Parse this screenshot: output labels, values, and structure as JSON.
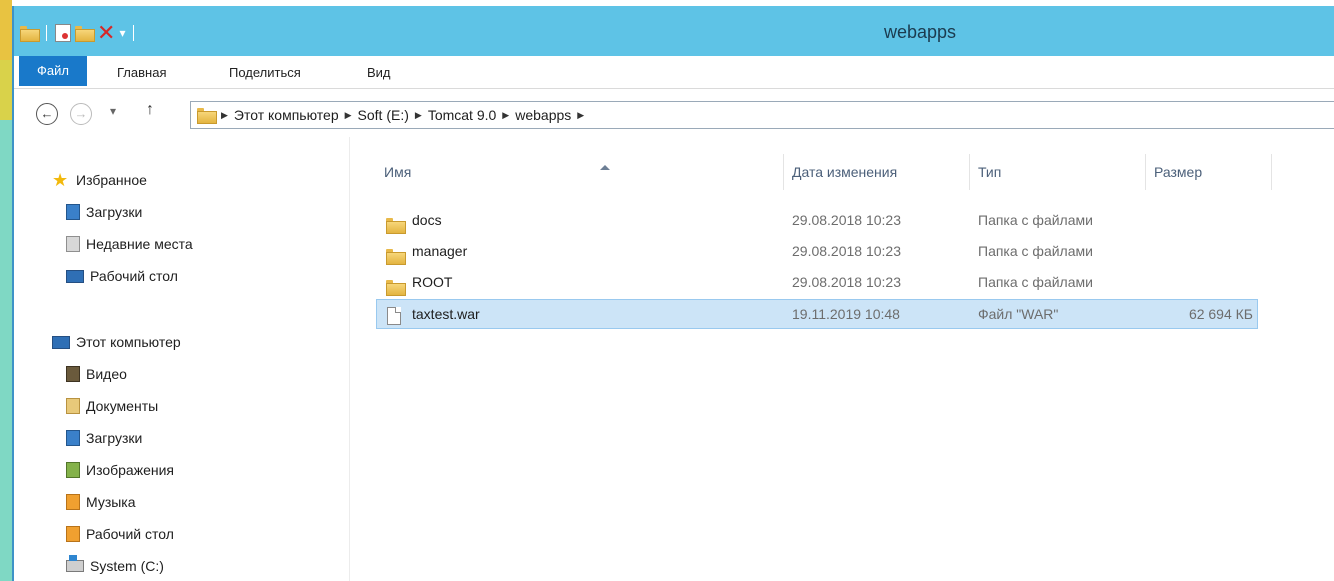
{
  "window": {
    "title": "webapps"
  },
  "ribbon": {
    "tabs": [
      "Файл",
      "Главная",
      "Поделиться",
      "Вид"
    ]
  },
  "address": {
    "crumbs": [
      "Этот компьютер",
      "Soft (E:)",
      "Tomcat 9.0",
      "webapps"
    ]
  },
  "navpane": {
    "favorites": {
      "label": "Избранное",
      "items": [
        "Загрузки",
        "Недавние места",
        "Рабочий стол"
      ]
    },
    "computer": {
      "label": "Этот компьютер",
      "items": [
        "Видео",
        "Документы",
        "Загрузки",
        "Изображения",
        "Музыка",
        "Рабочий стол",
        "System (C:)"
      ]
    }
  },
  "filelist": {
    "columns": [
      "Имя",
      "Дата изменения",
      "Тип",
      "Размер"
    ],
    "rows": [
      {
        "name": "docs",
        "date": "29.08.2018 10:23",
        "type": "Папка с файлами",
        "size": ""
      },
      {
        "name": "manager",
        "date": "29.08.2018 10:23",
        "type": "Папка с файлами",
        "size": ""
      },
      {
        "name": "ROOT",
        "date": "29.08.2018 10:23",
        "type": "Папка с файлами",
        "size": ""
      },
      {
        "name": "taxtest.war",
        "date": "19.11.2019 10:48",
        "type": "Файл \"WAR\"",
        "size": "62 694 КБ"
      }
    ]
  },
  "colors": {
    "titlebar": "#5ec3e6",
    "file_tab": "#1979ca",
    "selection": "#cce4f7"
  }
}
